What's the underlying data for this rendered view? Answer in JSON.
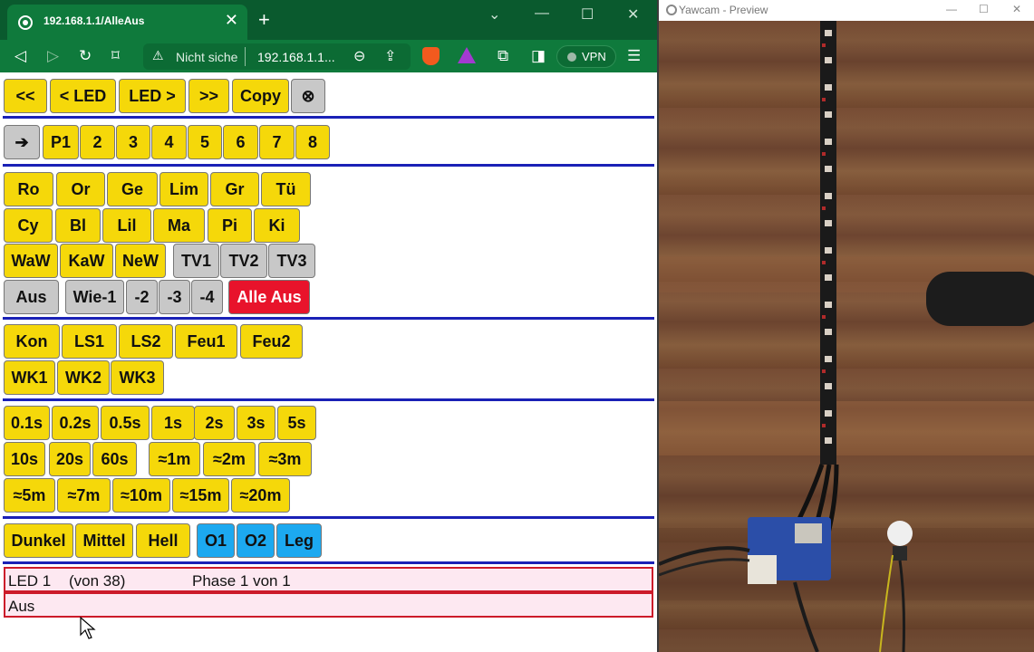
{
  "browser": {
    "tab_title": "192.168.1.1/AlleAus",
    "tab_close": "✕",
    "new_tab": "+",
    "address_warning": "Nicht siche",
    "url": "192.168.1.1...",
    "vpn_label": "VPN",
    "window_controls": [
      "⌄",
      "—",
      "☐",
      "✕"
    ]
  },
  "rows": {
    "nav": [
      "<<",
      "< LED",
      "LED >",
      ">>",
      "Copy",
      "⊗"
    ],
    "programs": [
      "➔",
      "P1",
      "2",
      "3",
      "4",
      "5",
      "6",
      "7",
      "8"
    ],
    "colors1": [
      "Ro",
      "Or",
      "Ge",
      "Lim",
      "Gr",
      "Tü"
    ],
    "colors2": [
      "Cy",
      "Bl",
      "Lil",
      "Ma",
      "Pi",
      "Ki"
    ],
    "whites": [
      "WaW",
      "KaW",
      "NeW",
      "TV1",
      "TV2",
      "TV3"
    ],
    "off": [
      "Aus",
      "Wie-1",
      "-2",
      "-3",
      "-4",
      "Alle Aus"
    ],
    "effects1": [
      "Kon",
      "LS1",
      "LS2",
      "Feu1",
      "Feu2"
    ],
    "effects2": [
      "WK1",
      "WK2",
      "WK3"
    ],
    "time1": [
      "0.1s",
      "0.2s",
      "0.5s",
      "1s",
      "2s",
      "3s",
      "5s"
    ],
    "time2": [
      "10s",
      "20s",
      "60s",
      "≈1m",
      "≈2m",
      "≈3m"
    ],
    "time3": [
      "≈5m",
      "≈7m",
      "≈10m",
      "≈15m",
      "≈20m"
    ],
    "brightness": [
      "Dunkel",
      "Mittel",
      "Hell",
      "O1",
      "O2",
      "Leg"
    ]
  },
  "status": {
    "led": "LED 1",
    "of_total": "(von 38)",
    "phase": "Phase 1 von 1",
    "state": "Aus"
  },
  "yawcam": {
    "title": "Yawcam - Preview",
    "controls": [
      "—",
      "☐",
      "✕"
    ]
  },
  "colors": {
    "button_yellow": "#f5d80a",
    "button_gray": "#c8c8c8",
    "button_blue": "#1ca9f0",
    "button_red": "#e8132b",
    "separator_blue": "#1a21b6",
    "status_border": "#cc1b2a",
    "status_fill": "#fde8f1",
    "browser_green": "#0f7a3c"
  }
}
